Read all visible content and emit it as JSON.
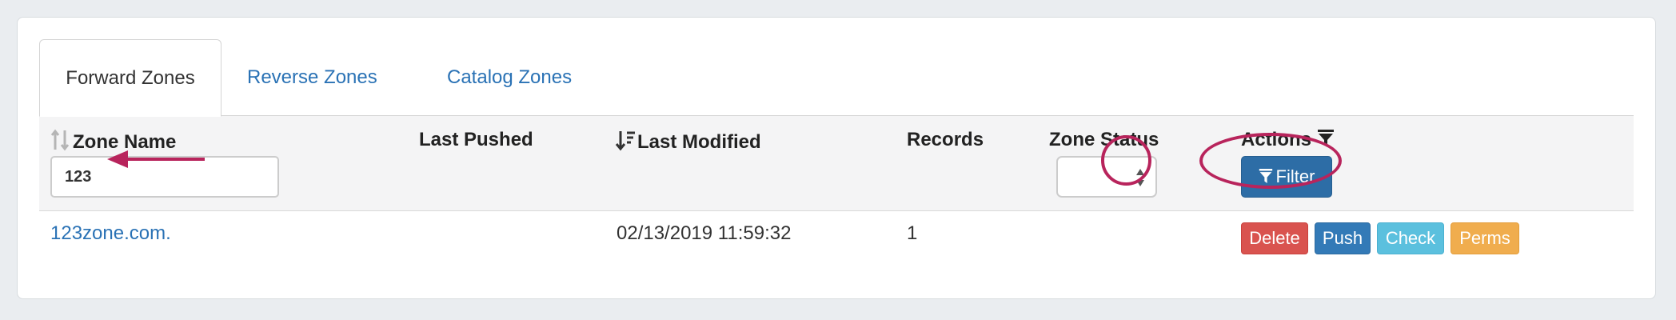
{
  "tabs": [
    {
      "label": "Forward Zones",
      "active": true
    },
    {
      "label": "Reverse Zones",
      "active": false
    },
    {
      "label": "Catalog Zones",
      "active": false
    }
  ],
  "table": {
    "headers": {
      "zone_name": "Zone Name",
      "last_pushed": "Last Pushed",
      "last_modified": "Last Modified",
      "records": "Records",
      "zone_status": "Zone Status",
      "actions": "Actions"
    },
    "filters": {
      "zone_name_value": "123",
      "zone_status_value": "",
      "filter_button_label": "Filter"
    },
    "rows": [
      {
        "zone_name": "123zone.com.",
        "last_pushed": "",
        "last_modified": "02/13/2019 11:59:32",
        "records": "1",
        "zone_status": "",
        "actions": {
          "delete": "Delete",
          "push": "Push",
          "check": "Check",
          "perms": "Perms"
        }
      }
    ]
  },
  "icons": {
    "sort": "sort-icon",
    "sort_desc": "sort-desc-icon",
    "funnel": "funnel-icon",
    "select_arrows": "updown-arrows-icon"
  },
  "colors": {
    "link": "#2a72b5",
    "filter_button": "#2d6da6",
    "delete": "#d9534f",
    "push": "#337ab7",
    "check": "#5bc0de",
    "perms": "#f0ad4e",
    "annotation": "#b8245c"
  }
}
